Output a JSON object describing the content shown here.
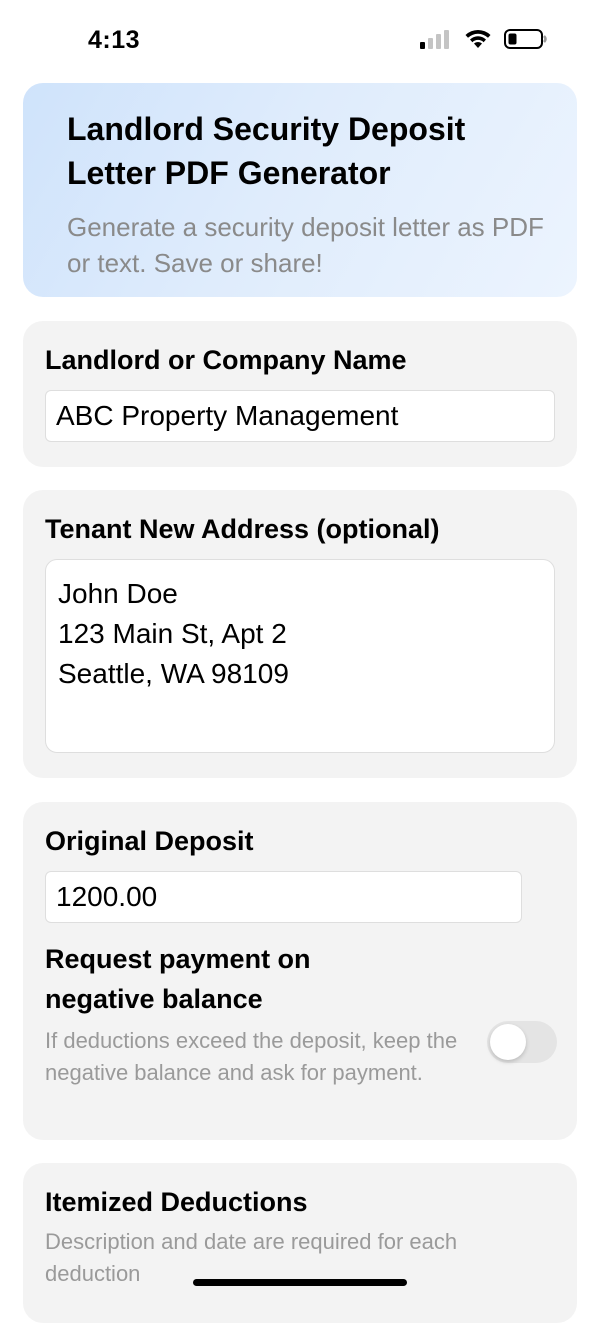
{
  "status_bar": {
    "time": "4:13",
    "signal_icon": "cellular-signal-icon",
    "wifi_icon": "wifi-icon",
    "battery_icon": "battery-low-icon"
  },
  "hero": {
    "title": "Landlord Security Deposit Letter PDF Generator",
    "subtitle": "Generate a security deposit letter as PDF or text. Save or share!"
  },
  "landlord": {
    "label": "Landlord or Company Name",
    "value": "ABC Property Management"
  },
  "tenant": {
    "label": "Tenant New Address (optional)",
    "lines": [
      "John Doe",
      "123 Main St, Apt 2",
      "Seattle, WA 98109"
    ]
  },
  "deposit": {
    "label": "Original Deposit",
    "value": "1200.00"
  },
  "negative_balance": {
    "title": "Request payment on negative balance",
    "description": "If deductions exceed the deposit, keep the negative balance and ask for payment.",
    "enabled": false
  },
  "deductions": {
    "title": "Itemized Deductions",
    "description": "Description and date are required for each deduction"
  },
  "colors": {
    "card_background": "#f3f3f3",
    "hero_gradient_start": "#cfe3fb",
    "hero_gradient_end": "#ecf4fe",
    "muted_text": "#8a8a8a"
  }
}
